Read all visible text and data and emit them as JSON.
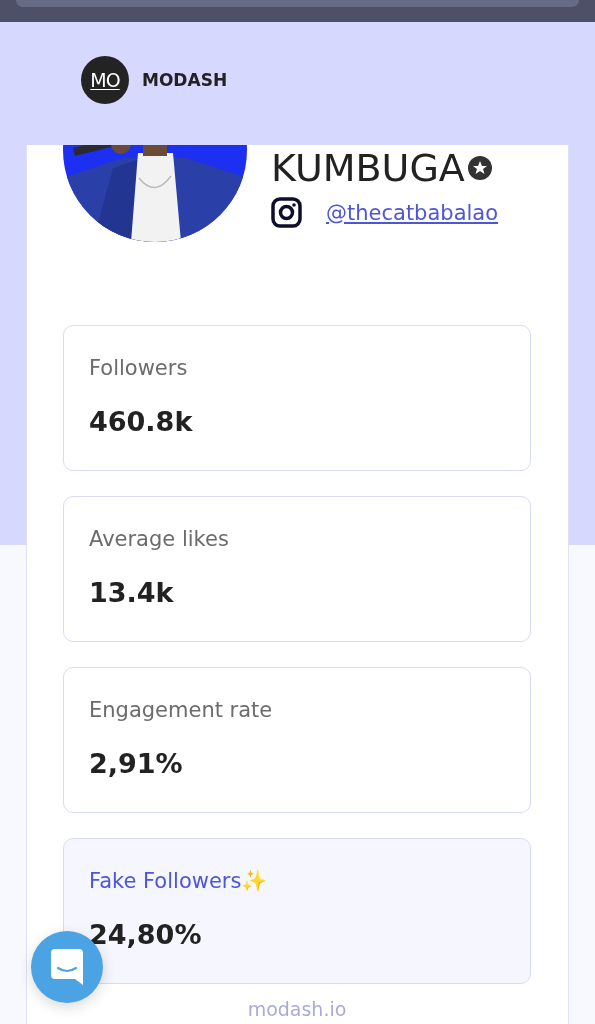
{
  "brand": {
    "logo": "MO",
    "name": "MODASH"
  },
  "profile": {
    "name": "KUMBUGA",
    "verified": true,
    "handle": "@thecatbabalao"
  },
  "stats": [
    {
      "label": "Followers",
      "value": "460.8k",
      "kind": "plain"
    },
    {
      "label": "Average likes",
      "value": "13.4k",
      "kind": "plain"
    },
    {
      "label": "Engagement rate",
      "value": "2,91%",
      "kind": "plain"
    },
    {
      "label": "Fake Followers✨",
      "value": "24,80%",
      "kind": "highlight"
    }
  ],
  "footer": "modash.io"
}
